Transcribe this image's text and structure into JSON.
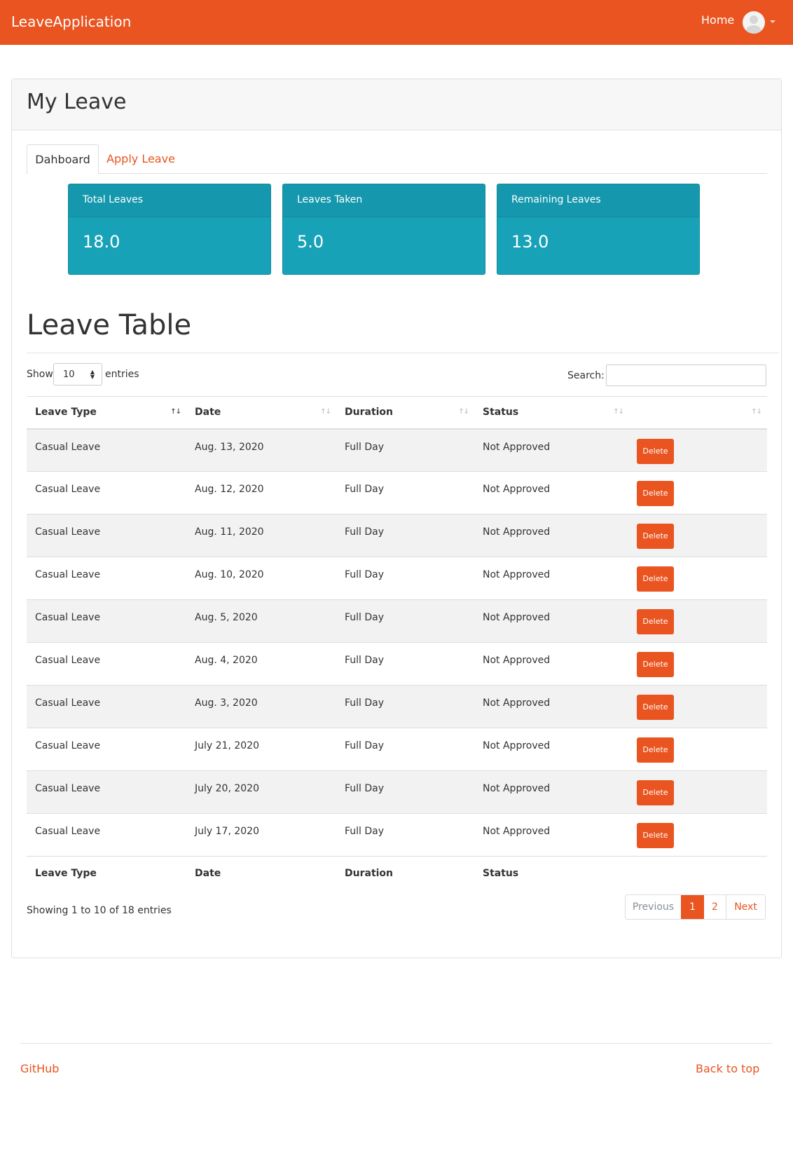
{
  "navbar": {
    "brand": "LeaveApplication",
    "home_label": "Home",
    "avatar_icon": "user-avatar-icon",
    "menu_icon": "caret-down-icon",
    "color": "#e95420"
  },
  "card": {
    "title": "My Leave"
  },
  "tabs": [
    {
      "label": "Dahboard",
      "active": true
    },
    {
      "label": "Apply Leave",
      "active": false
    }
  ],
  "stats": [
    {
      "label": "Total Leaves",
      "value": "18.0"
    },
    {
      "label": "Leaves Taken",
      "value": "5.0"
    },
    {
      "label": "Remaining Leaves",
      "value": "13.0"
    }
  ],
  "stats_color": "#17a2b8",
  "table": {
    "title": "Leave Table",
    "length": {
      "show_label": "Show",
      "selected": "10",
      "entries_label": "entries"
    },
    "search_label": "Search:",
    "search_value": "",
    "columns": [
      "Leave Type",
      "Date",
      "Duration",
      "Status",
      ""
    ],
    "rows": [
      {
        "type": "Casual Leave",
        "date": "Aug. 13, 2020",
        "duration": "Full Day",
        "status": "Not Approved",
        "action": "Delete"
      },
      {
        "type": "Casual Leave",
        "date": "Aug. 12, 2020",
        "duration": "Full Day",
        "status": "Not Approved",
        "action": "Delete"
      },
      {
        "type": "Casual Leave",
        "date": "Aug. 11, 2020",
        "duration": "Full Day",
        "status": "Not Approved",
        "action": "Delete"
      },
      {
        "type": "Casual Leave",
        "date": "Aug. 10, 2020",
        "duration": "Full Day",
        "status": "Not Approved",
        "action": "Delete"
      },
      {
        "type": "Casual Leave",
        "date": "Aug. 5, 2020",
        "duration": "Full Day",
        "status": "Not Approved",
        "action": "Delete"
      },
      {
        "type": "Casual Leave",
        "date": "Aug. 4, 2020",
        "duration": "Full Day",
        "status": "Not Approved",
        "action": "Delete"
      },
      {
        "type": "Casual Leave",
        "date": "Aug. 3, 2020",
        "duration": "Full Day",
        "status": "Not Approved",
        "action": "Delete"
      },
      {
        "type": "Casual Leave",
        "date": "July 21, 2020",
        "duration": "Full Day",
        "status": "Not Approved",
        "action": "Delete"
      },
      {
        "type": "Casual Leave",
        "date": "July 20, 2020",
        "duration": "Full Day",
        "status": "Not Approved",
        "action": "Delete"
      },
      {
        "type": "Casual Leave",
        "date": "July 17, 2020",
        "duration": "Full Day",
        "status": "Not Approved",
        "action": "Delete"
      }
    ],
    "footer_columns": [
      "Leave Type",
      "Date",
      "Duration",
      "Status"
    ],
    "info": "Showing 1 to 10 of 18 entries",
    "pagination": {
      "previous": "Previous",
      "pages": [
        "1",
        "2"
      ],
      "current": "1",
      "next": "Next"
    }
  },
  "footer": {
    "github": "GitHub",
    "back_to_top": "Back to top"
  }
}
